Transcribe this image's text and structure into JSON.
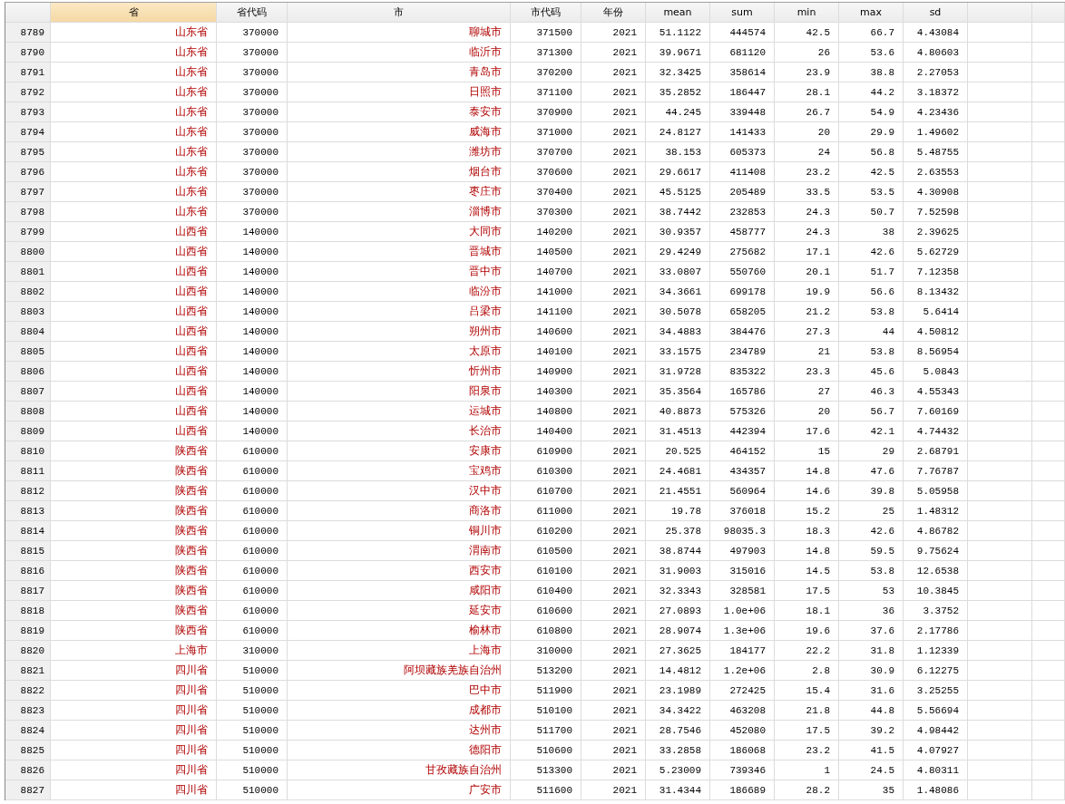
{
  "columns": [
    {
      "label": "省",
      "kind": "string",
      "selected": true
    },
    {
      "label": "省代码",
      "kind": "number",
      "selected": false
    },
    {
      "label": "市",
      "kind": "string",
      "selected": false
    },
    {
      "label": "市代码",
      "kind": "number",
      "selected": false
    },
    {
      "label": "年份",
      "kind": "number",
      "selected": false
    },
    {
      "label": "mean",
      "kind": "number",
      "selected": false
    },
    {
      "label": "sum",
      "kind": "number",
      "selected": false
    },
    {
      "label": "min",
      "kind": "number",
      "selected": false
    },
    {
      "label": "max",
      "kind": "number",
      "selected": false
    },
    {
      "label": "sd",
      "kind": "number",
      "selected": false
    }
  ],
  "rows": [
    {
      "row_number": "8789",
      "cells": [
        "山东省",
        "370000",
        "聊城市",
        "371500",
        "2021",
        "51.1122",
        "444574",
        "42.5",
        "66.7",
        "4.43084"
      ]
    },
    {
      "row_number": "8790",
      "cells": [
        "山东省",
        "370000",
        "临沂市",
        "371300",
        "2021",
        "39.9671",
        "681120",
        "26",
        "53.6",
        "4.80603"
      ]
    },
    {
      "row_number": "8791",
      "cells": [
        "山东省",
        "370000",
        "青岛市",
        "370200",
        "2021",
        "32.3425",
        "358614",
        "23.9",
        "38.8",
        "2.27053"
      ]
    },
    {
      "row_number": "8792",
      "cells": [
        "山东省",
        "370000",
        "日照市",
        "371100",
        "2021",
        "35.2852",
        "186447",
        "28.1",
        "44.2",
        "3.18372"
      ]
    },
    {
      "row_number": "8793",
      "cells": [
        "山东省",
        "370000",
        "泰安市",
        "370900",
        "2021",
        "44.245",
        "339448",
        "26.7",
        "54.9",
        "4.23436"
      ]
    },
    {
      "row_number": "8794",
      "cells": [
        "山东省",
        "370000",
        "威海市",
        "371000",
        "2021",
        "24.8127",
        "141433",
        "20",
        "29.9",
        "1.49602"
      ]
    },
    {
      "row_number": "8795",
      "cells": [
        "山东省",
        "370000",
        "潍坊市",
        "370700",
        "2021",
        "38.153",
        "605373",
        "24",
        "56.8",
        "5.48755"
      ]
    },
    {
      "row_number": "8796",
      "cells": [
        "山东省",
        "370000",
        "烟台市",
        "370600",
        "2021",
        "29.6617",
        "411408",
        "23.2",
        "42.5",
        "2.63553"
      ]
    },
    {
      "row_number": "8797",
      "cells": [
        "山东省",
        "370000",
        "枣庄市",
        "370400",
        "2021",
        "45.5125",
        "205489",
        "33.5",
        "53.5",
        "4.30908"
      ]
    },
    {
      "row_number": "8798",
      "cells": [
        "山东省",
        "370000",
        "淄博市",
        "370300",
        "2021",
        "38.7442",
        "232853",
        "24.3",
        "50.7",
        "7.52598"
      ]
    },
    {
      "row_number": "8799",
      "cells": [
        "山西省",
        "140000",
        "大同市",
        "140200",
        "2021",
        "30.9357",
        "458777",
        "24.3",
        "38",
        "2.39625"
      ]
    },
    {
      "row_number": "8800",
      "cells": [
        "山西省",
        "140000",
        "晋城市",
        "140500",
        "2021",
        "29.4249",
        "275682",
        "17.1",
        "42.6",
        "5.62729"
      ]
    },
    {
      "row_number": "8801",
      "cells": [
        "山西省",
        "140000",
        "晋中市",
        "140700",
        "2021",
        "33.0807",
        "550760",
        "20.1",
        "51.7",
        "7.12358"
      ]
    },
    {
      "row_number": "8802",
      "cells": [
        "山西省",
        "140000",
        "临汾市",
        "141000",
        "2021",
        "34.3661",
        "699178",
        "19.9",
        "56.6",
        "8.13432"
      ]
    },
    {
      "row_number": "8803",
      "cells": [
        "山西省",
        "140000",
        "吕梁市",
        "141100",
        "2021",
        "30.5078",
        "658205",
        "21.2",
        "53.8",
        "5.6414"
      ]
    },
    {
      "row_number": "8804",
      "cells": [
        "山西省",
        "140000",
        "朔州市",
        "140600",
        "2021",
        "34.4883",
        "384476",
        "27.3",
        "44",
        "4.50812"
      ]
    },
    {
      "row_number": "8805",
      "cells": [
        "山西省",
        "140000",
        "太原市",
        "140100",
        "2021",
        "33.1575",
        "234789",
        "21",
        "53.8",
        "8.56954"
      ]
    },
    {
      "row_number": "8806",
      "cells": [
        "山西省",
        "140000",
        "忻州市",
        "140900",
        "2021",
        "31.9728",
        "835322",
        "23.3",
        "45.6",
        "5.0843"
      ]
    },
    {
      "row_number": "8807",
      "cells": [
        "山西省",
        "140000",
        "阳泉市",
        "140300",
        "2021",
        "35.3564",
        "165786",
        "27",
        "46.3",
        "4.55343"
      ]
    },
    {
      "row_number": "8808",
      "cells": [
        "山西省",
        "140000",
        "运城市",
        "140800",
        "2021",
        "40.8873",
        "575326",
        "20",
        "56.7",
        "7.60169"
      ]
    },
    {
      "row_number": "8809",
      "cells": [
        "山西省",
        "140000",
        "长治市",
        "140400",
        "2021",
        "31.4513",
        "442394",
        "17.6",
        "42.1",
        "4.74432"
      ]
    },
    {
      "row_number": "8810",
      "cells": [
        "陕西省",
        "610000",
        "安康市",
        "610900",
        "2021",
        "20.525",
        "464152",
        "15",
        "29",
        "2.68791"
      ]
    },
    {
      "row_number": "8811",
      "cells": [
        "陕西省",
        "610000",
        "宝鸡市",
        "610300",
        "2021",
        "24.4681",
        "434357",
        "14.8",
        "47.6",
        "7.76787"
      ]
    },
    {
      "row_number": "8812",
      "cells": [
        "陕西省",
        "610000",
        "汉中市",
        "610700",
        "2021",
        "21.4551",
        "560964",
        "14.6",
        "39.8",
        "5.05958"
      ]
    },
    {
      "row_number": "8813",
      "cells": [
        "陕西省",
        "610000",
        "商洛市",
        "611000",
        "2021",
        "19.78",
        "376018",
        "15.2",
        "25",
        "1.48312"
      ]
    },
    {
      "row_number": "8814",
      "cells": [
        "陕西省",
        "610000",
        "铜川市",
        "610200",
        "2021",
        "25.378",
        "98035.3",
        "18.3",
        "42.6",
        "4.86782"
      ]
    },
    {
      "row_number": "8815",
      "cells": [
        "陕西省",
        "610000",
        "渭南市",
        "610500",
        "2021",
        "38.8744",
        "497903",
        "14.8",
        "59.5",
        "9.75624"
      ]
    },
    {
      "row_number": "8816",
      "cells": [
        "陕西省",
        "610000",
        "西安市",
        "610100",
        "2021",
        "31.9003",
        "315016",
        "14.5",
        "53.8",
        "12.6538"
      ]
    },
    {
      "row_number": "8817",
      "cells": [
        "陕西省",
        "610000",
        "咸阳市",
        "610400",
        "2021",
        "32.3343",
        "328581",
        "17.5",
        "53",
        "10.3845"
      ]
    },
    {
      "row_number": "8818",
      "cells": [
        "陕西省",
        "610000",
        "延安市",
        "610600",
        "2021",
        "27.0893",
        "1.0e+06",
        "18.1",
        "36",
        "3.3752"
      ]
    },
    {
      "row_number": "8819",
      "cells": [
        "陕西省",
        "610000",
        "榆林市",
        "610800",
        "2021",
        "28.9074",
        "1.3e+06",
        "19.6",
        "37.6",
        "2.17786"
      ]
    },
    {
      "row_number": "8820",
      "cells": [
        "上海市",
        "310000",
        "上海市",
        "310000",
        "2021",
        "27.3625",
        "184177",
        "22.2",
        "31.8",
        "1.12339"
      ]
    },
    {
      "row_number": "8821",
      "cells": [
        "四川省",
        "510000",
        "阿坝藏族羌族自治州",
        "513200",
        "2021",
        "14.4812",
        "1.2e+06",
        "2.8",
        "30.9",
        "6.12275"
      ]
    },
    {
      "row_number": "8822",
      "cells": [
        "四川省",
        "510000",
        "巴中市",
        "511900",
        "2021",
        "23.1989",
        "272425",
        "15.4",
        "31.6",
        "3.25255"
      ]
    },
    {
      "row_number": "8823",
      "cells": [
        "四川省",
        "510000",
        "成都市",
        "510100",
        "2021",
        "34.3422",
        "463208",
        "21.8",
        "44.8",
        "5.56694"
      ]
    },
    {
      "row_number": "8824",
      "cells": [
        "四川省",
        "510000",
        "达州市",
        "511700",
        "2021",
        "28.7546",
        "452080",
        "17.5",
        "39.2",
        "4.98442"
      ]
    },
    {
      "row_number": "8825",
      "cells": [
        "四川省",
        "510000",
        "德阳市",
        "510600",
        "2021",
        "33.2858",
        "186068",
        "23.2",
        "41.5",
        "4.07927"
      ]
    },
    {
      "row_number": "8826",
      "cells": [
        "四川省",
        "510000",
        "甘孜藏族自治州",
        "513300",
        "2021",
        "5.23009",
        "739346",
        "1",
        "24.5",
        "4.80311"
      ]
    },
    {
      "row_number": "8827",
      "cells": [
        "四川省",
        "510000",
        "广安市",
        "511600",
        "2021",
        "31.4344",
        "186689",
        "28.2",
        "35",
        "1.48086"
      ]
    }
  ]
}
